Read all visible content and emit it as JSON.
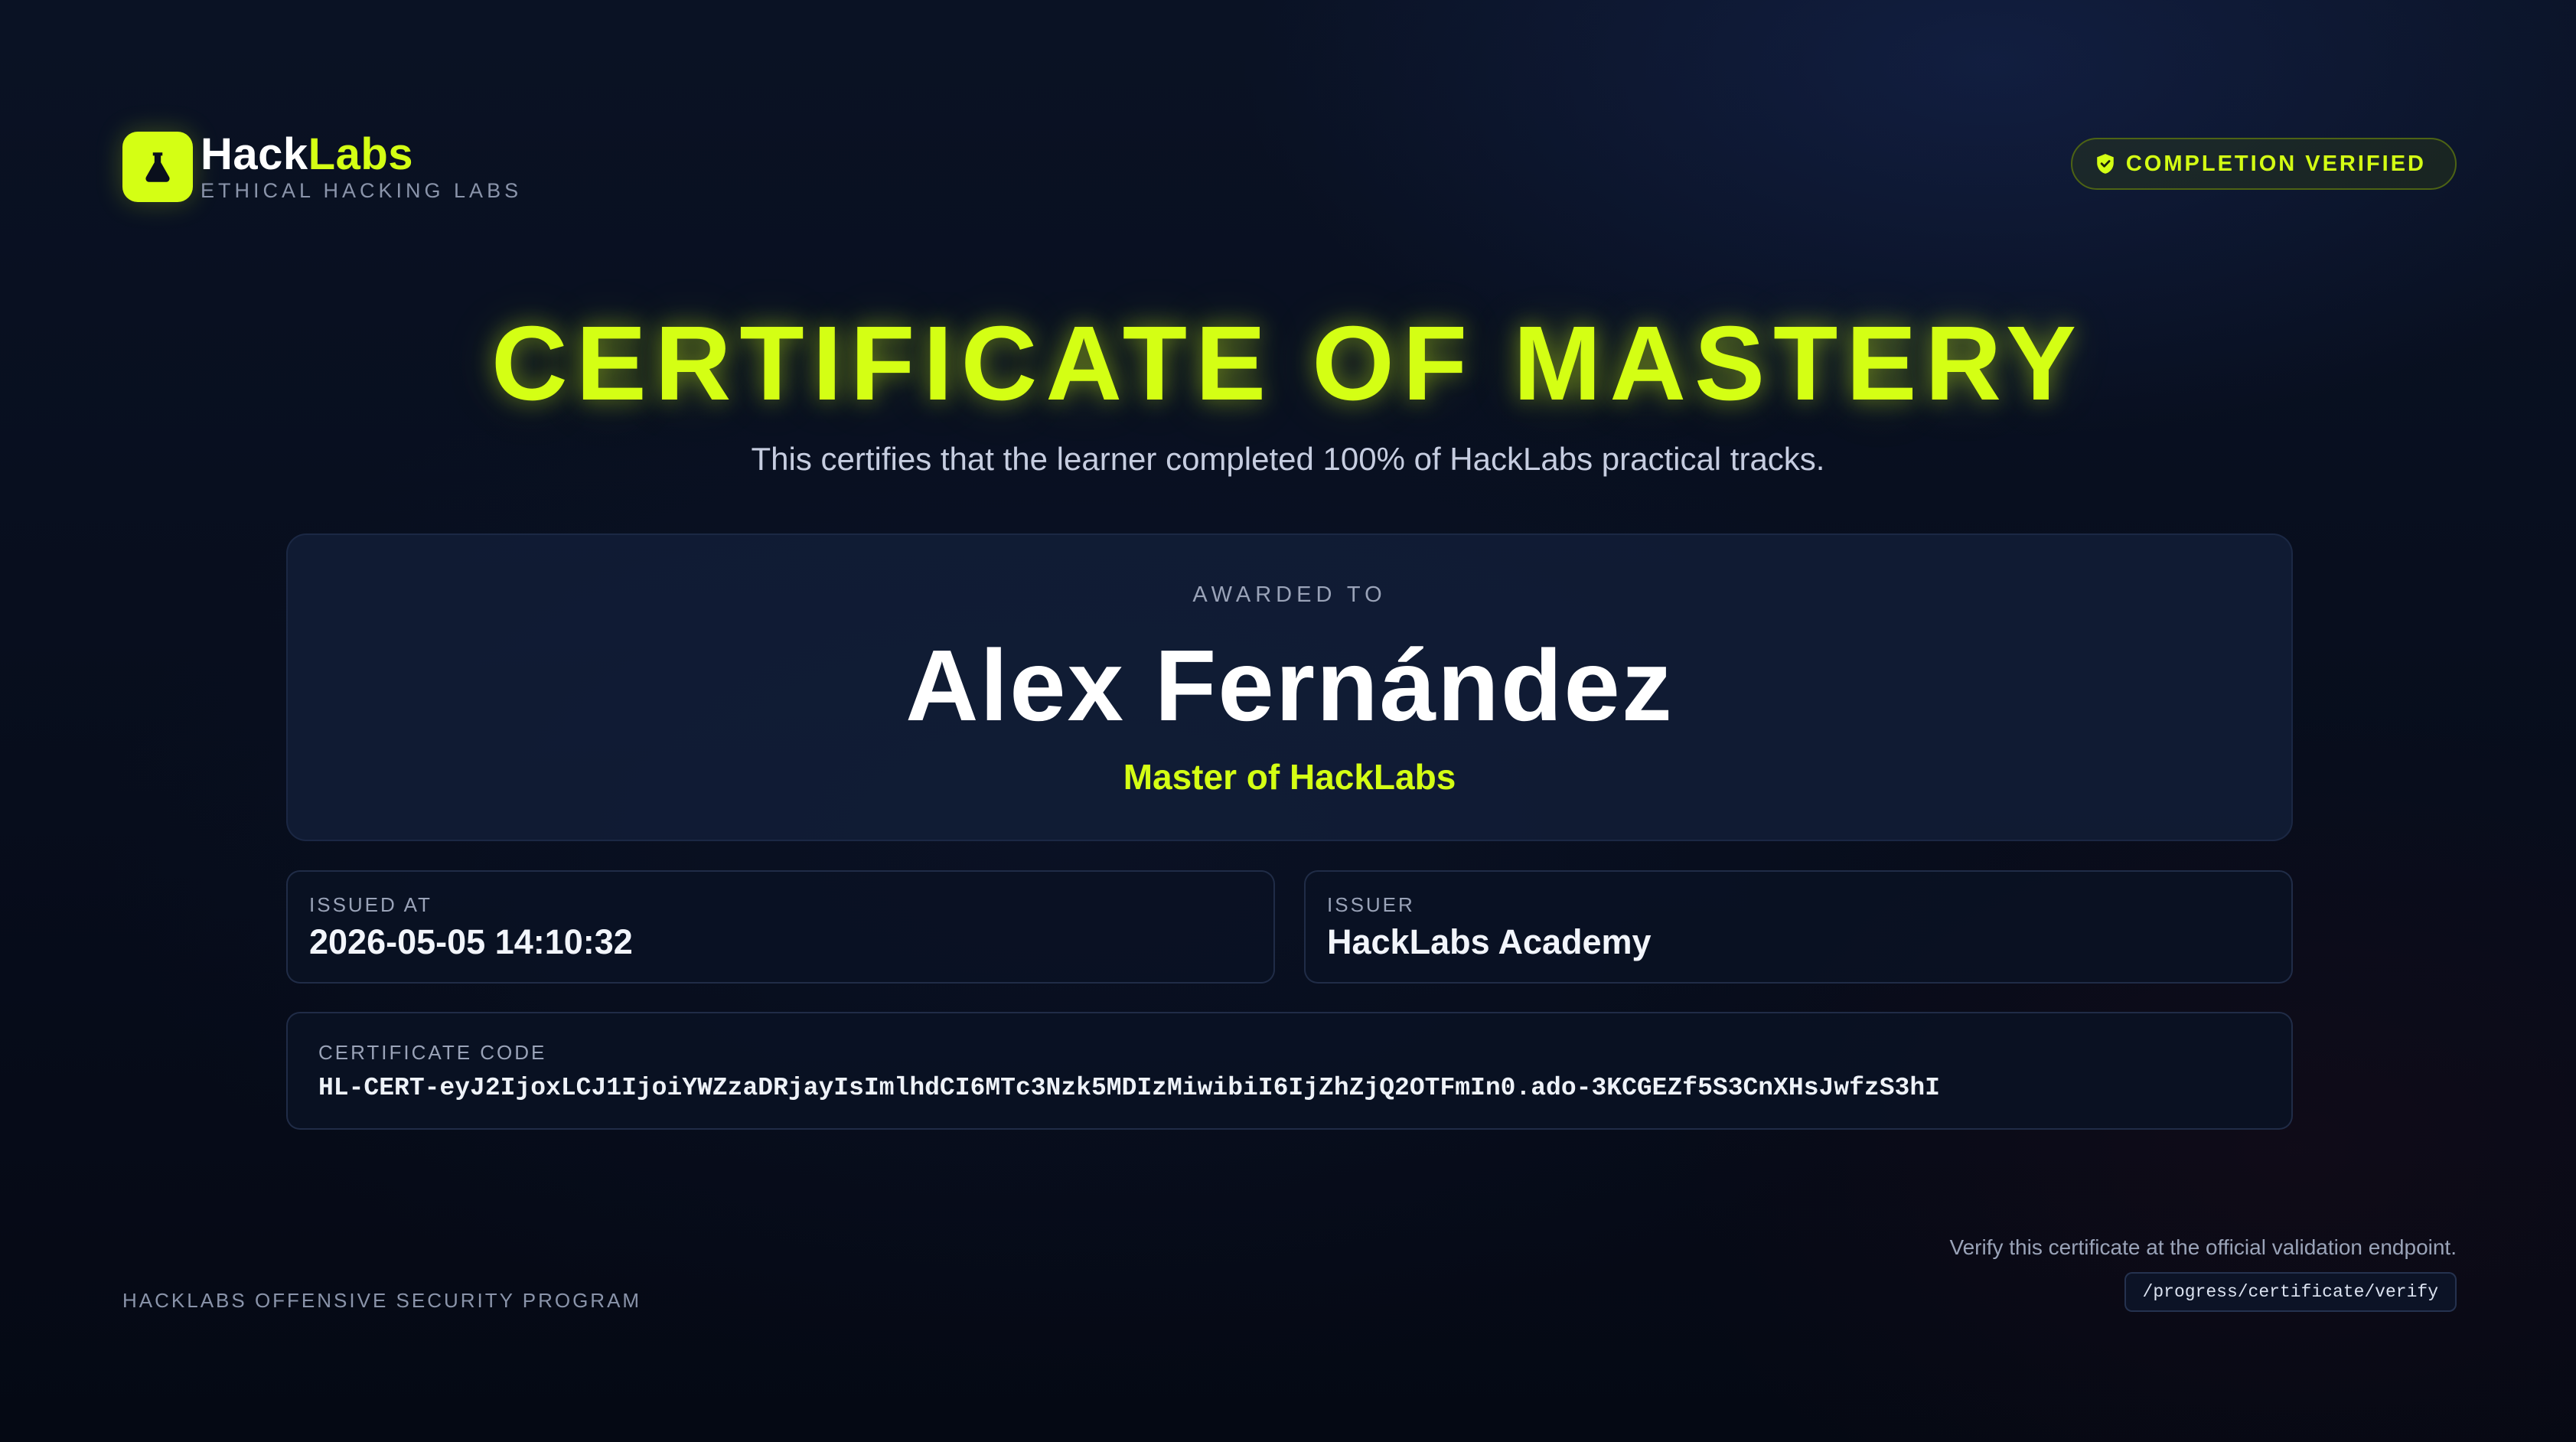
{
  "brand": {
    "name_part1": "Hack",
    "name_part2": "Labs",
    "tagline": "ETHICAL HACKING LABS",
    "logo_icon": "flask-icon",
    "accent_color": "#d4ff14"
  },
  "badge": {
    "label": "COMPLETION VERIFIED",
    "icon": "shield-check-icon"
  },
  "certificate": {
    "title": "CERTIFICATE OF MASTERY",
    "subtitle": "This certifies that the learner completed 100% of HackLabs practical tracks.",
    "awarded_label": "AWARDED TO",
    "recipient_name": "Alex Fernández",
    "rank": "Master of HackLabs"
  },
  "details": {
    "issued_at_label": "ISSUED AT",
    "issued_at_value": "2026-05-05 14:10:32",
    "issuer_label": "ISSUER",
    "issuer_value": "HackLabs Academy",
    "code_label": "CERTIFICATE CODE",
    "code_value": "HL-CERT-eyJ2IjoxLCJ1IjoiYWZzaDRjayIsImlhdCI6MTc3Nzk5MDIzMiwibiI6IjZhZjQ2OTFmIn0.ado-3KCGEZf5S3CnXHsJwfzS3hI"
  },
  "footer": {
    "program": "HACKLABS OFFENSIVE SECURITY PROGRAM",
    "verify_text": "Verify this certificate at the official validation endpoint.",
    "verify_endpoint": "/progress/certificate/verify"
  }
}
